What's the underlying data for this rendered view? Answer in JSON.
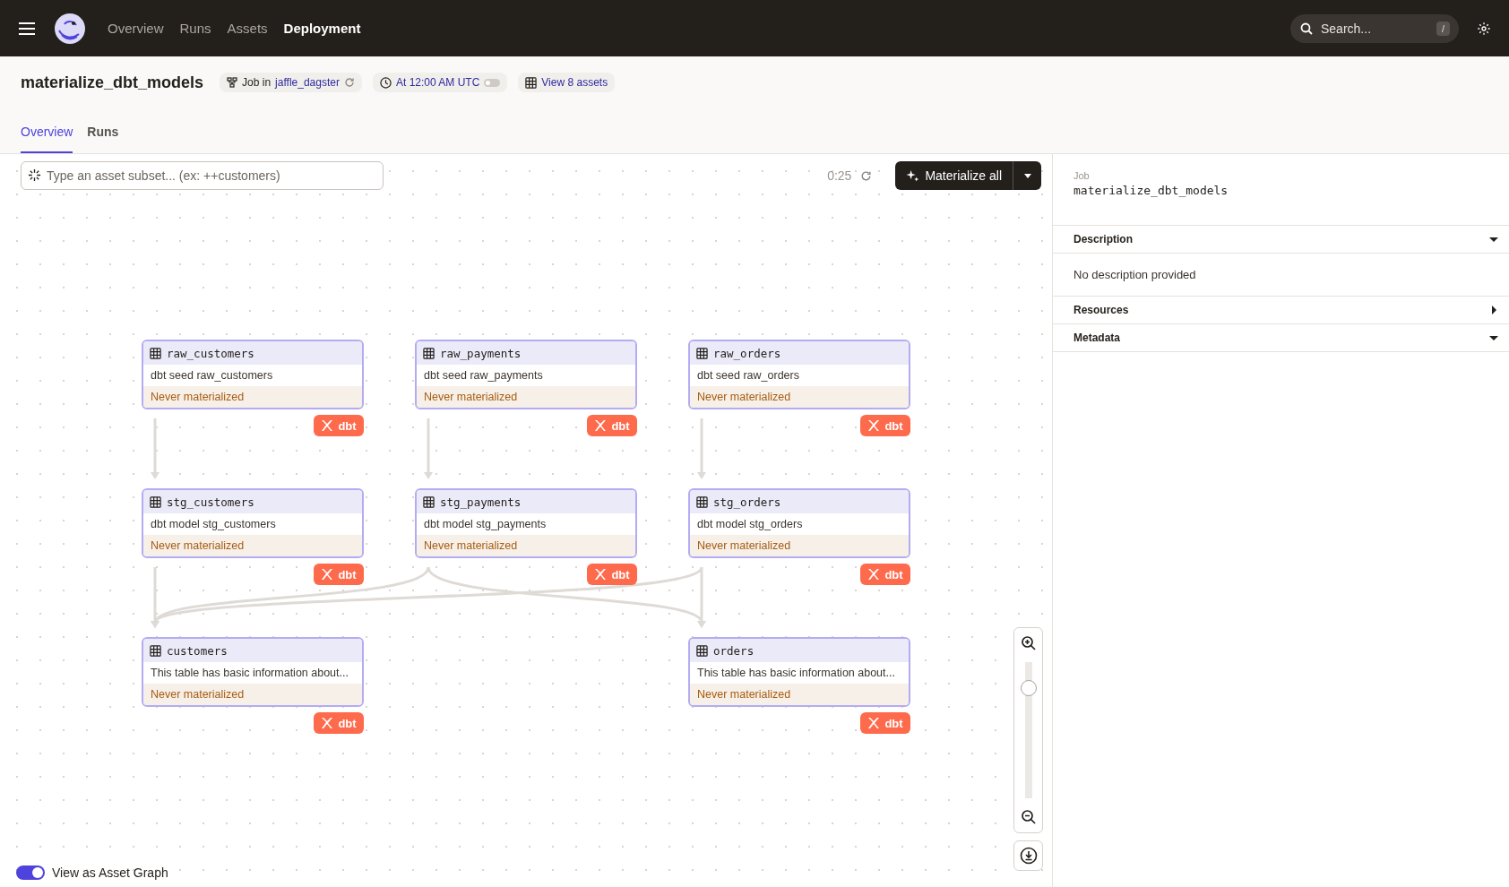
{
  "nav": {
    "items": [
      {
        "label": "Overview",
        "selected": false
      },
      {
        "label": "Runs",
        "selected": false
      },
      {
        "label": "Assets",
        "selected": false
      },
      {
        "label": "Deployment",
        "selected": true
      }
    ],
    "search": {
      "placeholder": "Search...",
      "shortcut": "/"
    }
  },
  "job": {
    "title": "materialize_dbt_models",
    "kind_label": "Job in",
    "repository": "jaffle_dagster",
    "schedule": {
      "label": "At 12:00 AM UTC",
      "on": false
    },
    "assets_link": "View 8 assets"
  },
  "tabs": [
    {
      "label": "Overview",
      "selected": true
    },
    {
      "label": "Runs",
      "selected": false
    }
  ],
  "toolbar": {
    "placeholder": "Type an asset subset... (ex: ++customers)",
    "refresh_timer": "0:25",
    "primary_button": "Materialize all"
  },
  "graph": {
    "rows": [
      [
        {
          "name": "raw_customers",
          "description": "dbt seed raw_customers",
          "status": "Never materialized",
          "badge": "dbt"
        },
        {
          "name": "raw_payments",
          "description": "dbt seed raw_payments",
          "status": "Never materialized",
          "badge": "dbt"
        },
        {
          "name": "raw_orders",
          "description": "dbt seed raw_orders",
          "status": "Never materialized",
          "badge": "dbt"
        }
      ],
      [
        {
          "name": "stg_customers",
          "description": "dbt model stg_customers",
          "status": "Never materialized",
          "badge": "dbt"
        },
        {
          "name": "stg_payments",
          "description": "dbt model stg_payments",
          "status": "Never materialized",
          "badge": "dbt"
        },
        {
          "name": "stg_orders",
          "description": "dbt model stg_orders",
          "status": "Never materialized",
          "badge": "dbt"
        }
      ],
      [
        {
          "name": "customers",
          "description": "This table has basic information about...",
          "status": "Never materialized",
          "badge": "dbt"
        },
        null,
        {
          "name": "orders",
          "description": "This table has basic information about...",
          "status": "Never materialized",
          "badge": "dbt"
        }
      ]
    ],
    "zoom": {
      "level": 0.85
    }
  },
  "view_toggle": {
    "label": "View as Asset Graph",
    "on": true
  },
  "sidebar": {
    "caption": "Job",
    "name": "materialize_dbt_models",
    "sections": [
      {
        "title": "Description",
        "expanded": true,
        "body": "No description provided"
      },
      {
        "title": "Resources",
        "expanded": false
      },
      {
        "title": "Metadata",
        "expanded": true
      }
    ]
  }
}
